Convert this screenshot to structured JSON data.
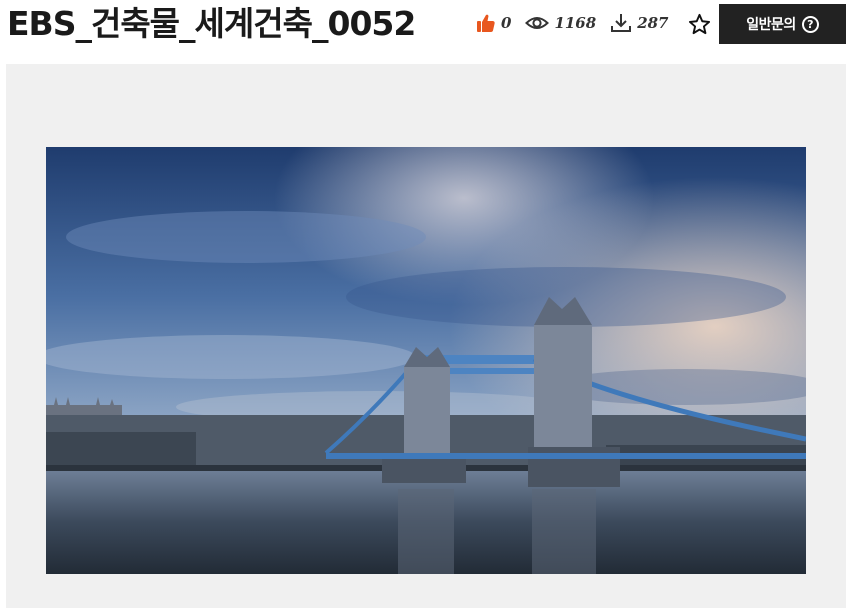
{
  "header": {
    "title": "EBS_건축물_세계건축_0052",
    "stats": {
      "likes": {
        "icon": "thumbs-up-icon",
        "value": "0",
        "color": "#e8571f"
      },
      "views": {
        "icon": "eye-icon",
        "value": "1168"
      },
      "downloads": {
        "icon": "download-icon",
        "value": "287"
      }
    },
    "favorite": {
      "icon": "star-outline-icon"
    },
    "inquiry_button": {
      "label": "일반문의",
      "icon": "question-circle-icon",
      "color": "#222222"
    }
  },
  "viewer": {
    "background": "#f0f0f0",
    "image": {
      "subject": "tower-bridge-photo"
    }
  }
}
